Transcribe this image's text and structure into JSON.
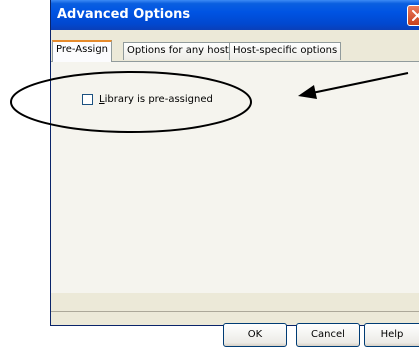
{
  "window": {
    "title": "Advanced Options",
    "close_icon": "close-icon"
  },
  "tabs": [
    {
      "label": "Pre-Assign",
      "active": true
    },
    {
      "label": "Options for any host",
      "active": false
    },
    {
      "label": "Host-specific options",
      "active": false
    }
  ],
  "pre_assign": {
    "checkbox_label_mnemonic": "L",
    "checkbox_label_rest": "ibrary is pre-assigned",
    "checked": false
  },
  "buttons": {
    "ok": "OK",
    "cancel": "Cancel",
    "help": "Help"
  },
  "colors": {
    "titlebar": "#0054e3",
    "dialog_bg": "#ece9d8",
    "active_tab_accent": "#e68b2c"
  },
  "annotation": {
    "shapes": [
      "ellipse",
      "arrow"
    ],
    "color": "#000000"
  }
}
